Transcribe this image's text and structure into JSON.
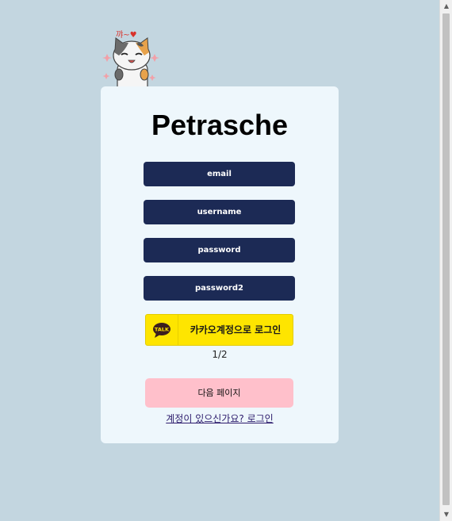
{
  "cat_sticker": {
    "caption": "꺄~♥",
    "icon": "cat-sticker-icon"
  },
  "form": {
    "title": "Petrasche",
    "fields": [
      {
        "name": "email",
        "placeholder": "email",
        "value": ""
      },
      {
        "name": "username",
        "placeholder": "username",
        "value": ""
      },
      {
        "name": "password",
        "placeholder": "password",
        "value": ""
      },
      {
        "name": "password2",
        "placeholder": "password2",
        "value": ""
      }
    ],
    "kakao_button": {
      "icon_text": "TALK",
      "label": "카카오계정으로 로그인"
    },
    "page_indicator": "1/2",
    "next_button": "다음 페이지",
    "login_link": "계정이 있으신가요? 로그인"
  },
  "colors": {
    "background": "#c3d6e0",
    "card": "#eef7fc",
    "input": "#1c2a55",
    "kakao": "#fee500",
    "next_button": "#ffc0cb"
  }
}
